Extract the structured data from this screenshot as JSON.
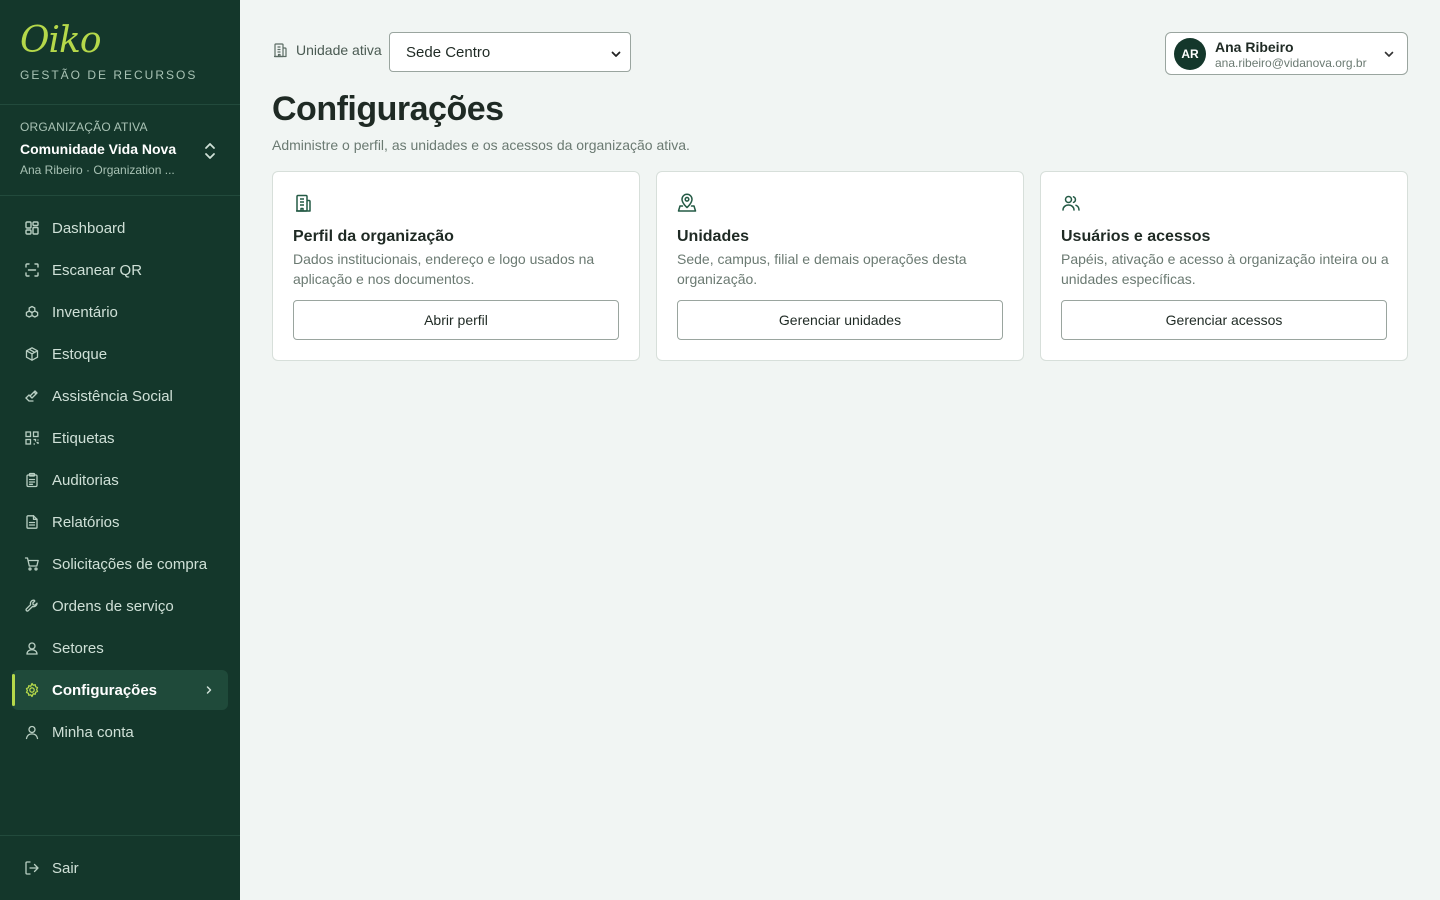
{
  "brand": {
    "logo": "Oiko",
    "subtitle": "GESTÃO DE RECURSOS",
    "accent": "#b5d84a"
  },
  "org": {
    "caption": "ORGANIZAÇÃO ATIVA",
    "name": "Comunidade Vida Nova",
    "meta": "Ana Ribeiro · Organization ..."
  },
  "nav": [
    {
      "label": "Dashboard",
      "icon": "grid-icon"
    },
    {
      "label": "Escanear QR",
      "icon": "scan-icon"
    },
    {
      "label": "Inventário",
      "icon": "boxes-icon"
    },
    {
      "label": "Estoque",
      "icon": "package-icon"
    },
    {
      "label": "Assistência Social",
      "icon": "hand-heart-icon"
    },
    {
      "label": "Etiquetas",
      "icon": "qr-code-icon"
    },
    {
      "label": "Auditorias",
      "icon": "clipboard-icon"
    },
    {
      "label": "Relatórios",
      "icon": "file-text-icon"
    },
    {
      "label": "Solicitações de compra",
      "icon": "cart-icon"
    },
    {
      "label": "Ordens de serviço",
      "icon": "wrench-icon"
    },
    {
      "label": "Setores",
      "icon": "user-pin-icon"
    },
    {
      "label": "Configurações",
      "icon": "gear-icon",
      "active": true
    },
    {
      "label": "Minha conta",
      "icon": "user-icon"
    }
  ],
  "logout": {
    "label": "Sair",
    "icon": "logout-icon"
  },
  "topbar": {
    "unit_label": "Unidade ativa",
    "unit_selected": "Sede Centro",
    "user": {
      "initials": "AR",
      "name": "Ana Ribeiro",
      "email": "ana.ribeiro@vidanova.org.br"
    }
  },
  "page": {
    "title": "Configurações",
    "subtitle": "Administre o perfil, as unidades e os acessos da organização ativa."
  },
  "cards": [
    {
      "icon": "building-icon",
      "title": "Perfil da organização",
      "description": "Dados institucionais, endereço e logo usados na aplicação e nos documentos.",
      "button": "Abrir perfil"
    },
    {
      "icon": "map-pin-icon",
      "title": "Unidades",
      "description": "Sede, campus, filial e demais operações desta organização.",
      "button": "Gerenciar unidades"
    },
    {
      "icon": "users-icon",
      "title": "Usuários e acessos",
      "description": "Papéis, ativação e acesso à organização inteira ou a unidades específicas.",
      "button": "Gerenciar acessos"
    }
  ]
}
